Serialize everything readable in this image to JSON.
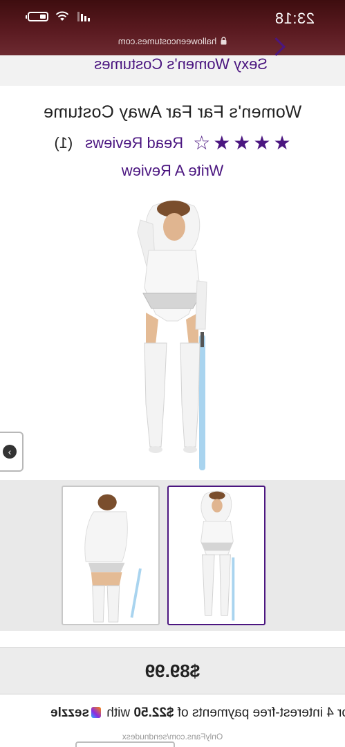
{
  "status_bar": {
    "time": "23:18",
    "url": "halloweencostumes.com"
  },
  "breadcrumb": {
    "category": "Sexy Women's Costumes"
  },
  "product": {
    "title": "Women's Far Far Away Costume",
    "rating": {
      "filled": 4,
      "total": 5
    },
    "read_reviews_label": "Read Reviews",
    "review_count": "(1)",
    "write_review_label": "Write A Review",
    "price": "$89.99",
    "thumbnails": [
      "thumbnail-front-view",
      "thumbnail-back-view"
    ]
  },
  "installments": {
    "prefix": "or 4 interest-free payments of",
    "amount": "$22.50",
    "with": "with",
    "brand": "sezzle"
  },
  "watermark": "OnlyFans.com/sendnudesx",
  "colors": {
    "accent": "#4b1680",
    "status_bar": "#4a1216",
    "price_bar": "#ececec",
    "thumb_strip": "#e9e9e9"
  },
  "icons": {
    "battery": "battery-icon",
    "wifi": "wifi-icon",
    "signal": "signal-icon",
    "lock": "lock-icon",
    "back": "chevron-left-icon",
    "star": "star-icon",
    "zoom": "chevron-right-icon"
  }
}
